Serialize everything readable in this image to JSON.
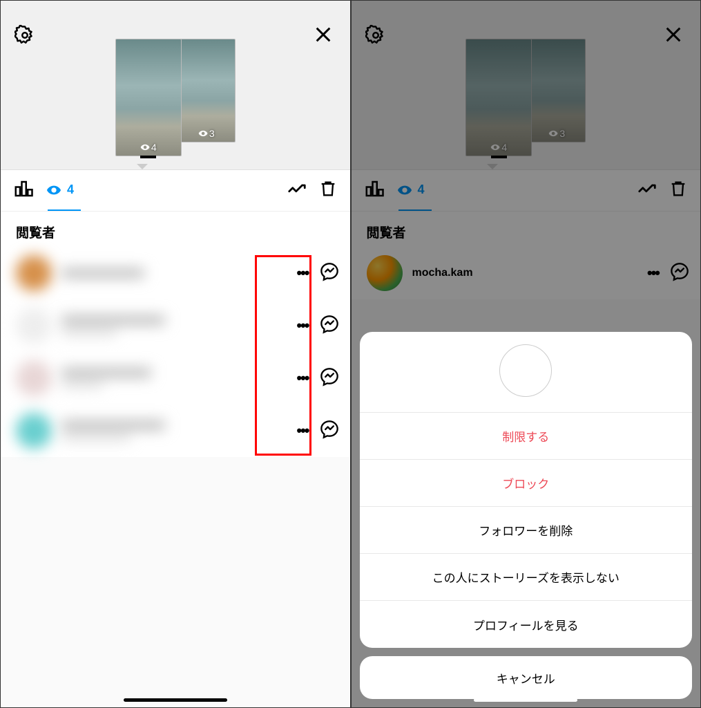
{
  "header": {
    "story_views": [
      {
        "count": "4"
      },
      {
        "count": "3"
      }
    ]
  },
  "stats": {
    "active_tab_view_count": "4"
  },
  "section_title": "閲覧者",
  "left_viewers": [
    {
      "avatar_color": "#d6904a"
    },
    {
      "avatar_color": "#eeeeee"
    },
    {
      "avatar_color": "#e8d6d6"
    },
    {
      "avatar_color": "#69cfcf"
    }
  ],
  "right_viewer": {
    "username": "mocha.kam"
  },
  "action_sheet": {
    "items": [
      {
        "label": "制限する",
        "destructive": true
      },
      {
        "label": "ブロック",
        "destructive": true
      },
      {
        "label": "フォロワーを削除",
        "destructive": false
      },
      {
        "label": "この人にストーリーズを表示しない",
        "destructive": false
      },
      {
        "label": "プロフィールを見る",
        "destructive": false
      }
    ],
    "cancel": "キャンセル"
  }
}
